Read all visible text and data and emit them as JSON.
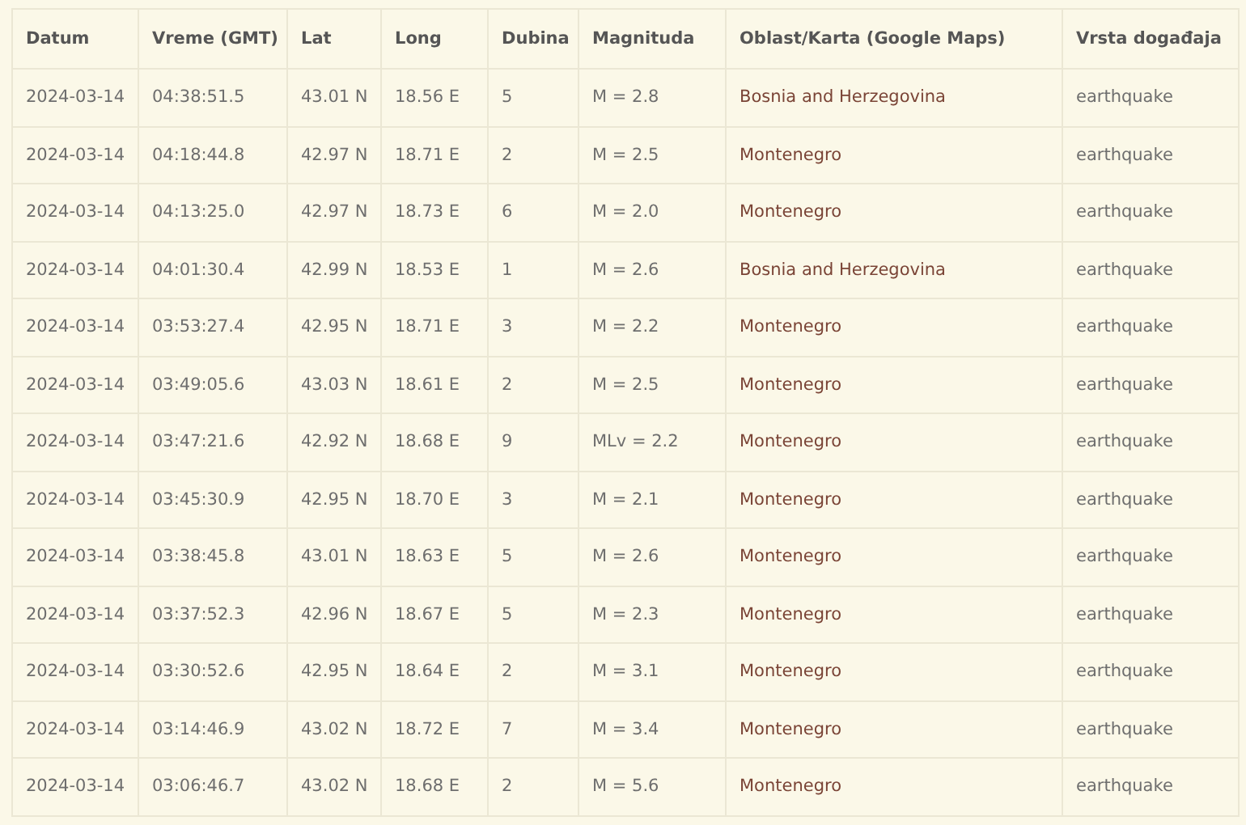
{
  "table": {
    "columns": [
      "Datum",
      "Vreme (GMT)",
      "Lat",
      "Long",
      "Dubina",
      "Magnituda",
      "Oblast/Karta (Google Maps)",
      "Vrsta događaja"
    ],
    "rows": [
      {
        "date": "2024-03-14",
        "time": "04:38:51.5",
        "lat": "43.01 N",
        "long": "18.56 E",
        "depth": "5",
        "magnitude": "M = 2.8",
        "region": "Bosnia and Herzegovina",
        "type": "earthquake"
      },
      {
        "date": "2024-03-14",
        "time": "04:18:44.8",
        "lat": "42.97 N",
        "long": "18.71 E",
        "depth": "2",
        "magnitude": "M = 2.5",
        "region": "Montenegro",
        "type": "earthquake"
      },
      {
        "date": "2024-03-14",
        "time": "04:13:25.0",
        "lat": "42.97 N",
        "long": "18.73 E",
        "depth": "6",
        "magnitude": "M = 2.0",
        "region": "Montenegro",
        "type": "earthquake"
      },
      {
        "date": "2024-03-14",
        "time": "04:01:30.4",
        "lat": "42.99 N",
        "long": "18.53 E",
        "depth": "1",
        "magnitude": "M = 2.6",
        "region": "Bosnia and Herzegovina",
        "type": "earthquake"
      },
      {
        "date": "2024-03-14",
        "time": "03:53:27.4",
        "lat": "42.95 N",
        "long": "18.71 E",
        "depth": "3",
        "magnitude": "M = 2.2",
        "region": "Montenegro",
        "type": "earthquake"
      },
      {
        "date": "2024-03-14",
        "time": "03:49:05.6",
        "lat": "43.03 N",
        "long": "18.61 E",
        "depth": "2",
        "magnitude": "M = 2.5",
        "region": "Montenegro",
        "type": "earthquake"
      },
      {
        "date": "2024-03-14",
        "time": "03:47:21.6",
        "lat": "42.92 N",
        "long": "18.68 E",
        "depth": "9",
        "magnitude": "MLv = 2.2",
        "region": "Montenegro",
        "type": "earthquake"
      },
      {
        "date": "2024-03-14",
        "time": "03:45:30.9",
        "lat": "42.95 N",
        "long": "18.70 E",
        "depth": "3",
        "magnitude": "M = 2.1",
        "region": "Montenegro",
        "type": "earthquake"
      },
      {
        "date": "2024-03-14",
        "time": "03:38:45.8",
        "lat": "43.01 N",
        "long": "18.63 E",
        "depth": "5",
        "magnitude": "M = 2.6",
        "region": "Montenegro",
        "type": "earthquake"
      },
      {
        "date": "2024-03-14",
        "time": "03:37:52.3",
        "lat": "42.96 N",
        "long": "18.67 E",
        "depth": "5",
        "magnitude": "M = 2.3",
        "region": "Montenegro",
        "type": "earthquake"
      },
      {
        "date": "2024-03-14",
        "time": "03:30:52.6",
        "lat": "42.95 N",
        "long": "18.64 E",
        "depth": "2",
        "magnitude": "M = 3.1",
        "region": "Montenegro",
        "type": "earthquake"
      },
      {
        "date": "2024-03-14",
        "time": "03:14:46.9",
        "lat": "43.02 N",
        "long": "18.72 E",
        "depth": "7",
        "magnitude": "M = 3.4",
        "region": "Montenegro",
        "type": "earthquake"
      },
      {
        "date": "2024-03-14",
        "time": "03:06:46.7",
        "lat": "43.02 N",
        "long": "18.68 E",
        "depth": "2",
        "magnitude": "M = 5.6",
        "region": "Montenegro",
        "type": "earthquake"
      }
    ]
  }
}
